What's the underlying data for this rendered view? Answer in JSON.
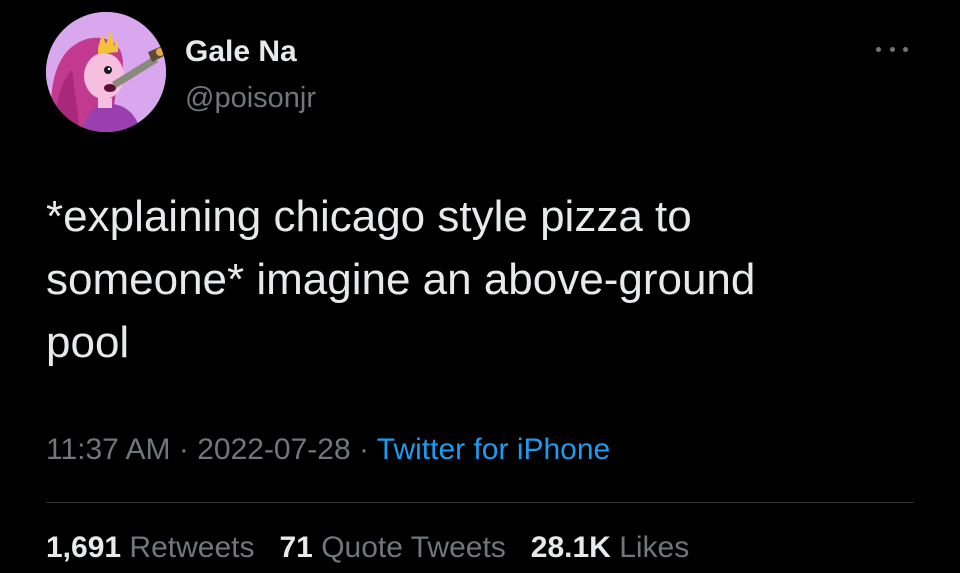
{
  "author": {
    "name": "Gale Na",
    "handle": "@poisonjr",
    "avatar_icon": "princess-bubblegum-avatar"
  },
  "tweet": {
    "text": "*explaining chicago style pizza to\nsomeone* imagine an above-ground\npool"
  },
  "meta": {
    "time": "11:37 AM",
    "separator": " · ",
    "date": "2022-07-28",
    "source": "Twitter for iPhone"
  },
  "stats": {
    "retweets_count": "1,691",
    "retweets_label": "Retweets",
    "quote_tweets_count": "71",
    "quote_tweets_label": "Quote Tweets",
    "likes_count": "28.1K",
    "likes_label": "Likes"
  },
  "colors": {
    "background": "#000000",
    "primary_text": "#e7e9ea",
    "secondary_text": "#71767b",
    "link": "#1d9bf0",
    "divider": "#2f3336"
  },
  "icons": {
    "more": "more-dots-icon"
  }
}
